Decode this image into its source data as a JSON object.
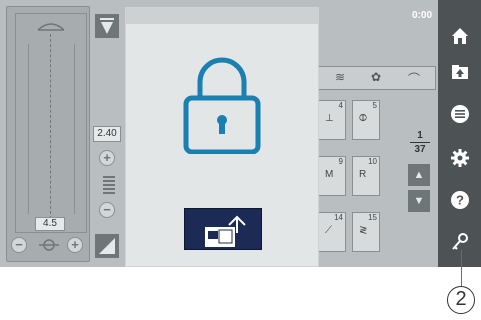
{
  "screen": {
    "time": "0:00",
    "left_panel": {
      "bottom_value": "4.5",
      "minus_label": "−",
      "plus_label": "+"
    },
    "width_column": {
      "value": "2.40",
      "plus_label": "+",
      "minus_label": "−"
    },
    "stitch_area": {
      "stitches": [
        {
          "num": "4"
        },
        {
          "num": "5"
        },
        {
          "num": "9",
          "glyph": "M"
        },
        {
          "num": "10",
          "glyph": "R"
        },
        {
          "num": "14"
        },
        {
          "num": "15"
        }
      ],
      "page": {
        "current": "1",
        "total": "37"
      }
    },
    "sidebar": {
      "icons": [
        "home-icon",
        "upload-icon",
        "menu-icon",
        "gear-icon",
        "help-icon",
        "key-icon"
      ]
    }
  },
  "dialog": {
    "icon": "lock-icon",
    "button_icon": "unlock-screen-icon"
  },
  "callout": {
    "label": "2"
  },
  "colors": {
    "screen_bg": "#b9bec0",
    "sidebar_bg": "#4d5254",
    "lock_color": "#1a7fb1",
    "unlock_button": "#1c2b55",
    "callout_line": "#e5373f"
  }
}
